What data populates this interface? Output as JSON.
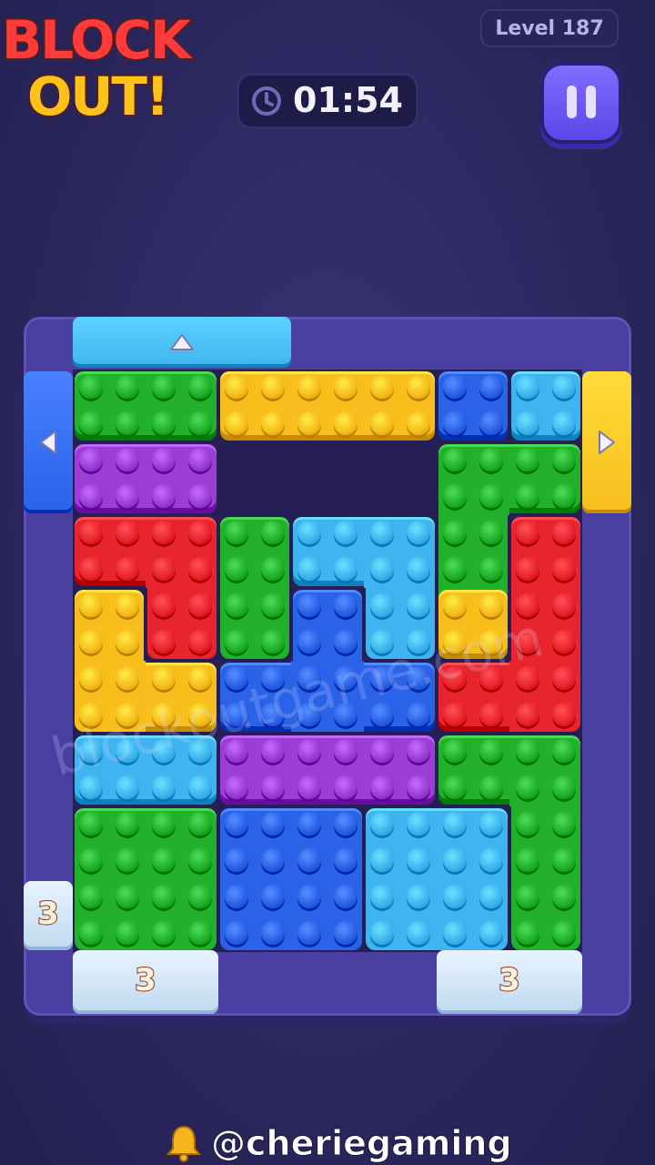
{
  "logo": {
    "line1": "BLOCK",
    "line2": "OUT!"
  },
  "level": {
    "label": "Level 187"
  },
  "timer": {
    "time": "01:54"
  },
  "footer": {
    "handle": "@cheriegaming"
  },
  "watermark": {
    "text": "blockoutgame.com"
  },
  "colors": {
    "green": "#21b12a",
    "yellow": "#f7be1c",
    "blue": "#2a62e8",
    "lightblue": "#3fb4f0",
    "purple": "#9b3ed6",
    "red": "#e8242c",
    "board": "#4a3fa0",
    "empty": "#261f55"
  },
  "grid": {
    "cols": 7,
    "rows": 8
  },
  "blocks": [
    {
      "name": "green-block-top-left",
      "color": "green",
      "cells": [
        [
          0,
          0
        ],
        [
          1,
          0
        ]
      ]
    },
    {
      "name": "yellow-block-top",
      "color": "yellow",
      "cells": [
        [
          2,
          0
        ],
        [
          3,
          0
        ],
        [
          4,
          0
        ]
      ]
    },
    {
      "name": "blue-block-top-small",
      "color": "blue",
      "cells": [
        [
          5,
          0
        ]
      ]
    },
    {
      "name": "lightblue-block-top-small",
      "color": "lightblue",
      "cells": [
        [
          6,
          0
        ]
      ]
    },
    {
      "name": "purple-block-row2",
      "color": "purple",
      "cells": [
        [
          0,
          1
        ],
        [
          1,
          1
        ]
      ]
    },
    {
      "name": "green-block-right-s",
      "color": "green",
      "cells": [
        [
          5,
          1
        ],
        [
          6,
          1
        ],
        [
          5,
          2
        ],
        [
          5,
          3
        ]
      ]
    },
    {
      "name": "red-block-left",
      "color": "red",
      "cells": [
        [
          0,
          2
        ],
        [
          1,
          2
        ],
        [
          1,
          3
        ]
      ]
    },
    {
      "name": "green-block-mid-vertical",
      "color": "green",
      "cells": [
        [
          2,
          2
        ],
        [
          2,
          3
        ]
      ]
    },
    {
      "name": "lightblue-block-center",
      "color": "lightblue",
      "cells": [
        [
          3,
          2
        ],
        [
          4,
          2
        ],
        [
          4,
          3
        ]
      ]
    },
    {
      "name": "red-block-right",
      "color": "red",
      "cells": [
        [
          6,
          2
        ],
        [
          6,
          3
        ],
        [
          6,
          4
        ],
        [
          5,
          4
        ]
      ]
    },
    {
      "name": "yellow-block-left-l",
      "color": "yellow",
      "cells": [
        [
          0,
          3
        ],
        [
          0,
          4
        ],
        [
          1,
          4
        ]
      ]
    },
    {
      "name": "blue-block-center",
      "color": "blue",
      "cells": [
        [
          3,
          3
        ],
        [
          2,
          4
        ],
        [
          3,
          4
        ],
        [
          4,
          4
        ]
      ]
    },
    {
      "name": "yellow-block-right-small",
      "color": "yellow",
      "cells": [
        [
          5,
          3
        ]
      ]
    },
    {
      "name": "lightblue-block-left",
      "color": "lightblue",
      "cells": [
        [
          0,
          5
        ],
        [
          1,
          5
        ]
      ]
    },
    {
      "name": "purple-block-center",
      "color": "purple",
      "cells": [
        [
          2,
          5
        ],
        [
          3,
          5
        ],
        [
          4,
          5
        ]
      ]
    },
    {
      "name": "green-block-right-tall",
      "color": "green",
      "cells": [
        [
          5,
          5
        ],
        [
          6,
          5
        ],
        [
          6,
          6
        ],
        [
          6,
          7
        ]
      ]
    },
    {
      "name": "green-block-bottom-left",
      "color": "green",
      "cells": [
        [
          0,
          6
        ],
        [
          1,
          6
        ],
        [
          0,
          7
        ],
        [
          1,
          7
        ]
      ]
    },
    {
      "name": "blue-block-bottom",
      "color": "blue",
      "cells": [
        [
          2,
          6
        ],
        [
          3,
          6
        ],
        [
          2,
          7
        ],
        [
          3,
          7
        ]
      ]
    },
    {
      "name": "lightblue-block-bottom",
      "color": "lightblue",
      "cells": [
        [
          4,
          6
        ],
        [
          5,
          6
        ],
        [
          4,
          7
        ],
        [
          5,
          7
        ]
      ]
    }
  ],
  "gates": [
    {
      "name": "gate-top-lightblue",
      "color": "lightblue",
      "side": "top",
      "start": 0,
      "span": 3,
      "arrow": "up"
    },
    {
      "name": "gate-left-blue",
      "color": "blue",
      "side": "left",
      "start": 0,
      "span": 2,
      "arrow": "left"
    },
    {
      "name": "gate-right-yellow",
      "color": "yellow",
      "side": "right",
      "start": 0,
      "span": 2,
      "arrow": "right"
    },
    {
      "name": "gate-left-ice",
      "color": "ice",
      "side": "left",
      "start": 7,
      "span": 1,
      "count": "3"
    },
    {
      "name": "gate-bottom-ice-left",
      "color": "ice",
      "side": "bottom",
      "start": 0,
      "span": 2,
      "count": "3"
    },
    {
      "name": "gate-bottom-ice-right",
      "color": "ice",
      "side": "bottom",
      "start": 5,
      "span": 2,
      "count": "3"
    }
  ]
}
